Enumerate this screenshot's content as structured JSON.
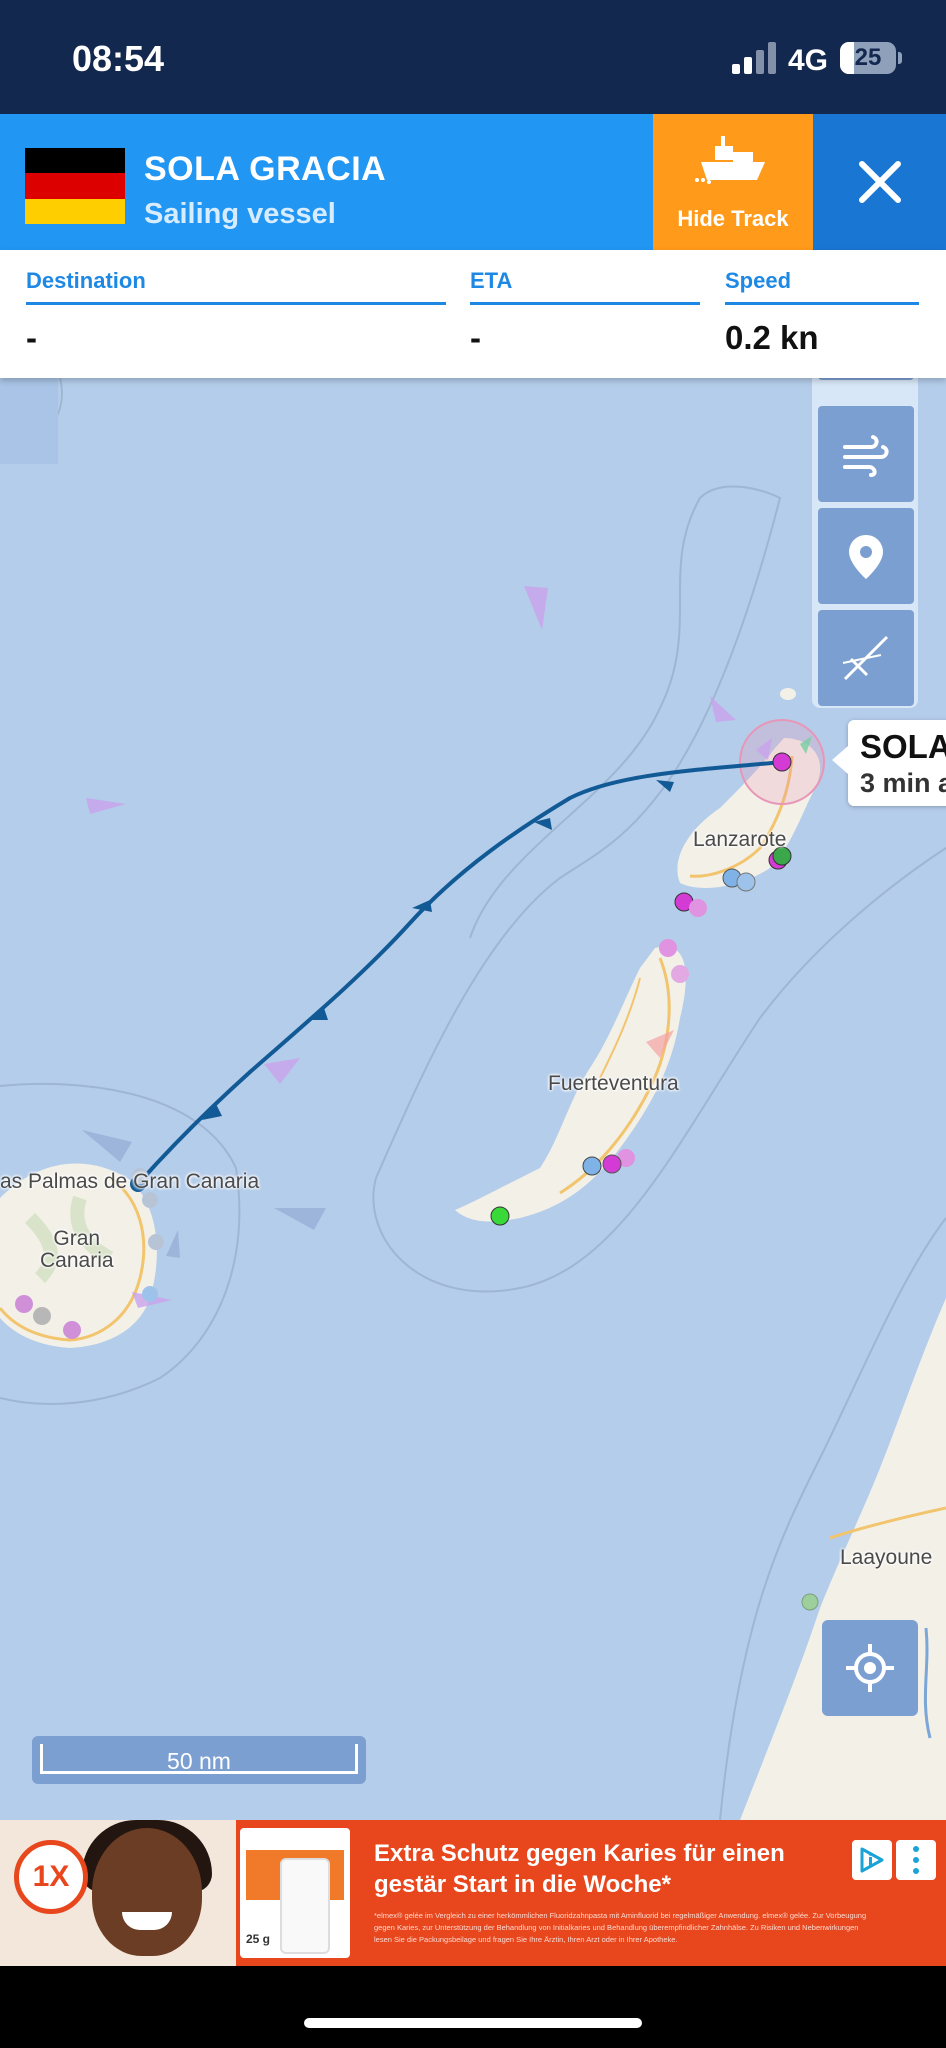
{
  "status_bar": {
    "time": "08:54",
    "network": "4G",
    "battery": "25"
  },
  "vessel": {
    "name": "SOLA GRACIA",
    "type": "Sailing vessel",
    "flag": "germany-flag",
    "flag_colors": [
      "#000000",
      "#dd0000",
      "#ffce00"
    ],
    "hide_track_label": "Hide Track"
  },
  "info": {
    "destination_label": "Destination",
    "destination_value": "-",
    "eta_label": "ETA",
    "eta_value": "-",
    "speed_label": "Speed",
    "speed_value": "0.2 kn"
  },
  "map": {
    "labels": {
      "las_palmas": "as Palmas de Gran Canaria",
      "gran_canaria": "Gran\nCanaria",
      "fuerteventura": "Fuerteventura",
      "lanzarote": "Lanzarote",
      "laayoune": "Laayoune"
    },
    "callout": {
      "name": "SOLA",
      "time": "3 min a"
    },
    "scale": "50 nm",
    "tools": [
      "layers-icon",
      "wind-icon",
      "location-pin-icon",
      "measure-icon"
    ],
    "colors": {
      "sea": "#b4cdea",
      "land": "#f3f0e8",
      "track": "#125a96",
      "buttons": "#7b9fd1"
    }
  },
  "ad": {
    "headline": "Extra Schutz gegen Karies für einen gestär Start in die Woche*",
    "badge": "1X",
    "pack_size": "25 g",
    "fine_print": "*elmex® gelée im Vergleich zu einer herkömmlichen Fluoridzahnpasta mit Aminfluorid bei regelmäßiger Anwendung. elmex® gelée. Zur Vorbeugung gegen Karies, zur Unterstützung der Behandlung von Initialkaries und Behandlung überempfindlicher Zahnhälse. Zu Risiken und Nebenwirkungen lesen Sie die Packungsbeilage und fragen Sie Ihre Ärztin, Ihren Arzt oder in Ihrer Apotheke."
  }
}
